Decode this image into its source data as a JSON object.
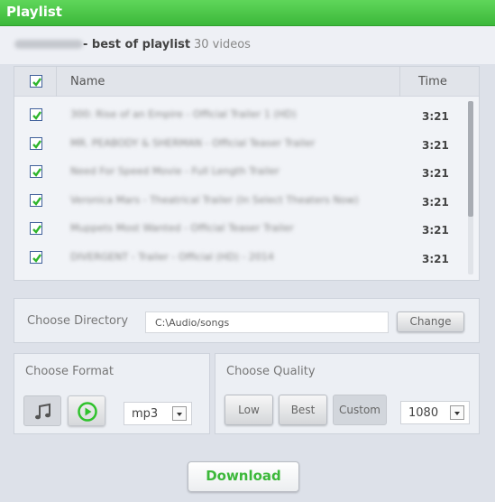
{
  "window": {
    "title": "Playlist"
  },
  "playlist": {
    "owner": "Rick Sogel",
    "name_prefix": "- ",
    "name": "best of playlist",
    "count_label": "30 videos"
  },
  "table": {
    "select_all_checked": true,
    "columns": {
      "name": "Name",
      "time": "Time"
    },
    "rows": [
      {
        "checked": true,
        "name": "300: Rise of an Empire - Official Trailer 1 (HD)",
        "time": "3:21"
      },
      {
        "checked": true,
        "name": "MR. PEABODY & SHERMAN - Official Teaser Trailer",
        "time": "3:21"
      },
      {
        "checked": true,
        "name": "Need For Speed Movie - Full Length Trailer",
        "time": "3:21"
      },
      {
        "checked": true,
        "name": "Veronica Mars - Theatrical Trailer (In Select Theaters Now)",
        "time": "3:21"
      },
      {
        "checked": true,
        "name": "Muppets Most Wanted - Official Teaser Trailer",
        "time": "3:21"
      },
      {
        "checked": true,
        "name": "DIVERGENT - Trailer - Official (HD) - 2014",
        "time": "3:21"
      }
    ]
  },
  "directory": {
    "label": "Choose Directory",
    "value": "C:\\Audio/songs",
    "change_label": "Change"
  },
  "format": {
    "label": "Choose Format",
    "audio_icon": "music-note-icon",
    "video_icon": "play-circle-icon",
    "selected": "mp3"
  },
  "quality": {
    "label": "Choose Quality",
    "buttons": [
      "Low",
      "Best",
      "Custom"
    ],
    "active": "Custom",
    "selected": "1080"
  },
  "download_label": "Download",
  "colors": {
    "accent_green": "#3cb83a",
    "titlebar_green": "#4fc94b",
    "background": "#dde1e9"
  }
}
